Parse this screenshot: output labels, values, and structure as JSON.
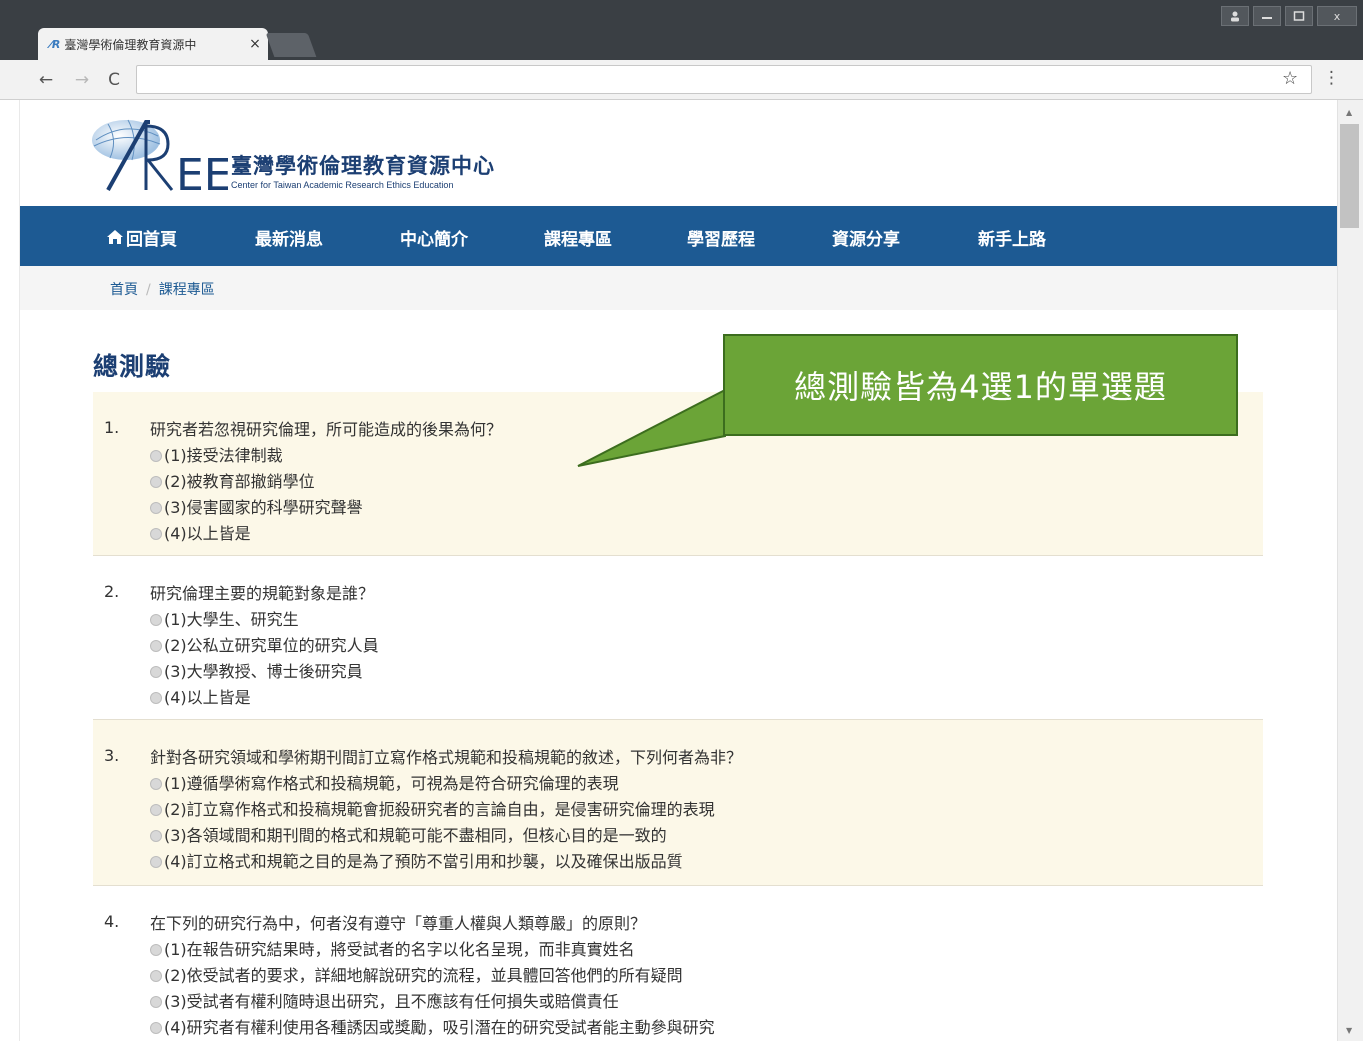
{
  "browser": {
    "tab_title": "臺灣學術倫理教育資源中",
    "tab_close": "×",
    "url": "",
    "window_controls": {
      "user": "👤",
      "minimize": "—",
      "maximize": "☐",
      "close": "x"
    }
  },
  "site": {
    "logo_text": "臺灣學術倫理教育資源中心",
    "logo_subtitle": "Center for Taiwan Academic Research Ethics Education",
    "logo_mark": "AREE"
  },
  "nav": {
    "items": [
      {
        "label": "回首頁",
        "icon": "home-icon"
      },
      {
        "label": "最新消息"
      },
      {
        "label": "中心簡介"
      },
      {
        "label": "課程專區"
      },
      {
        "label": "學習歷程"
      },
      {
        "label": "資源分享"
      },
      {
        "label": "新手上路"
      }
    ]
  },
  "breadcrumb": {
    "home": "首頁",
    "separator": "/",
    "current": "課程專區"
  },
  "page": {
    "title": "總測驗"
  },
  "callout": {
    "text": "總測驗皆為4選1的單選題",
    "color": "#6ba437"
  },
  "questions": [
    {
      "number": "1.",
      "text": "研究者若忽視研究倫理，所可能造成的後果為何？",
      "options": [
        "(1)接受法律制裁",
        "(2)被教育部撤銷學位",
        "(3)侵害國家的科學研究聲譽",
        "(4)以上皆是"
      ]
    },
    {
      "number": "2.",
      "text": "研究倫理主要的規範對象是誰？",
      "options": [
        "(1)大學生、研究生",
        "(2)公私立研究單位的研究人員",
        "(3)大學教授、博士後研究員",
        "(4)以上皆是"
      ]
    },
    {
      "number": "3.",
      "text": "針對各研究領域和學術期刊間訂立寫作格式規範和投稿規範的敘述，下列何者為非？",
      "options": [
        "(1)遵循學術寫作格式和投稿規範，可視為是符合研究倫理的表現",
        "(2)訂立寫作格式和投稿規範會扼殺研究者的言論自由，是侵害研究倫理的表現",
        "(3)各領域間和期刊間的格式和規範可能不盡相同，但核心目的是一致的",
        "(4)訂立格式和規範之目的是為了預防不當引用和抄襲，以及確保出版品質"
      ]
    },
    {
      "number": "4.",
      "text": "在下列的研究行為中，何者沒有遵守「尊重人權與人類尊嚴」的原則？",
      "options": [
        "(1)在報告研究結果時，將受試者的名字以化名呈現，而非真實姓名",
        "(2)依受試者的要求，詳細地解說研究的流程，並具體回答他們的所有疑問",
        "(3)受試者有權利隨時退出研究，且不應該有任何損失或賠償責任",
        "(4)研究者有權利使用各種誘因或獎勵，吸引潛在的研究受試者能主動參與研究"
      ]
    }
  ]
}
